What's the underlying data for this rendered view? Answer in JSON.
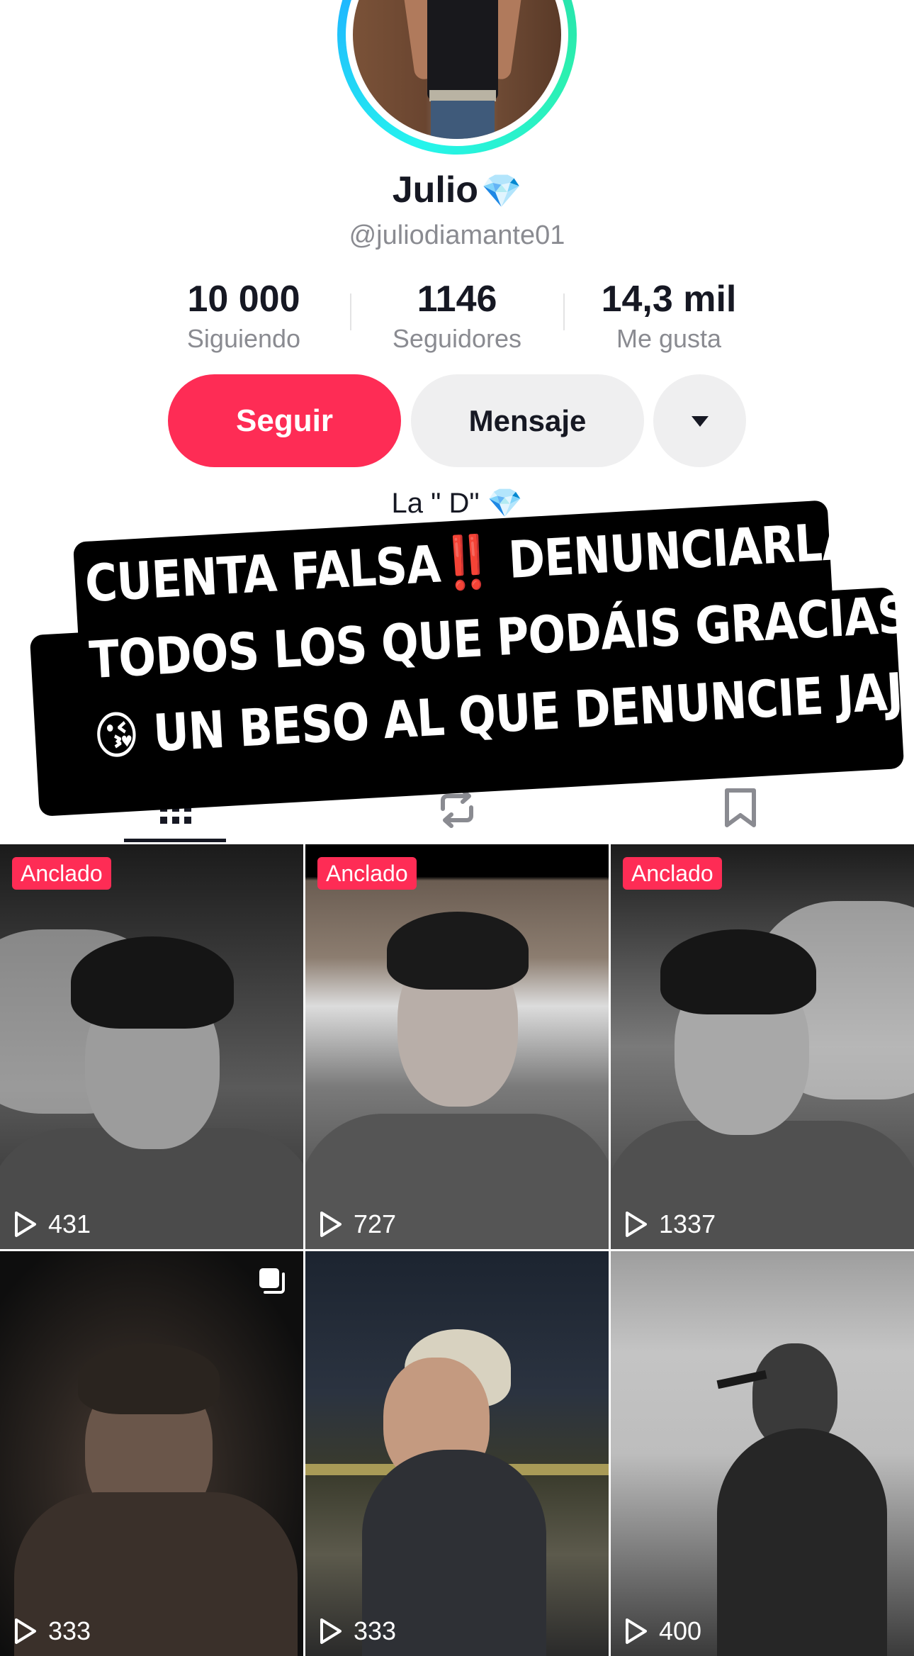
{
  "profile": {
    "name": "Julio",
    "name_emoji": "💎",
    "username": "@juliodiamante01",
    "bio": "La \" D\" 💎"
  },
  "stats": [
    {
      "value": "10 000",
      "label": "Siguiendo"
    },
    {
      "value": "1146",
      "label": "Seguidores"
    },
    {
      "value": "14,3 mil",
      "label": "Me gusta"
    }
  ],
  "actions": {
    "follow_label": "Seguir",
    "message_label": "Mensaje"
  },
  "tabs": {
    "icons": [
      "grid-icon",
      "repost-icon",
      "bookmark-icon"
    ],
    "active": "grid-icon"
  },
  "overlay": {
    "line1_a": "CUENTA FALSA",
    "line1_bang": "‼️",
    "line1_b": " DENUNCIARLA",
    "line2": "TODOS LOS QUE PODÁIS GRACIAS 😘",
    "line3": "😘 UN BESO AL QUE DENUNCIE JAJA"
  },
  "videos": [
    {
      "pinned": true,
      "pin_label": "Anclado",
      "views": "431"
    },
    {
      "pinned": true,
      "pin_label": "Anclado",
      "views": "727"
    },
    {
      "pinned": true,
      "pin_label": "Anclado",
      "views": "1337"
    },
    {
      "pinned": false,
      "pin_label": "",
      "views": "333",
      "multi": true
    },
    {
      "pinned": false,
      "pin_label": "",
      "views": "333"
    },
    {
      "pinned": false,
      "pin_label": "",
      "views": "400"
    }
  ],
  "colors": {
    "accent": "#fe2c55",
    "secondary_button": "#efeff0",
    "text_primary": "#161823",
    "text_secondary": "#8a8b91",
    "ring_gradient": [
      "#25f4ee",
      "#20d5a9"
    ]
  }
}
